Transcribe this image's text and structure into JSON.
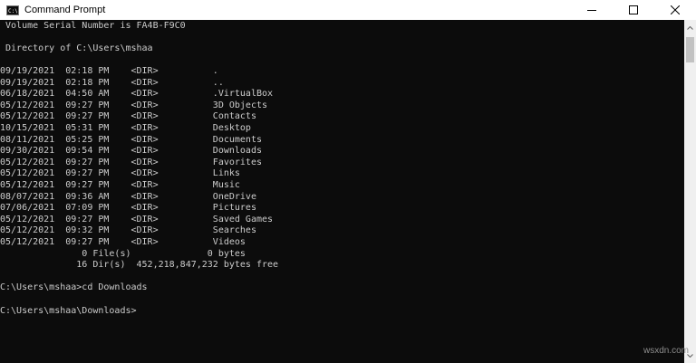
{
  "window": {
    "title": "Command Prompt"
  },
  "console": {
    "lines": [
      " Volume Serial Number is FA4B-F9C0",
      "",
      " Directory of C:\\Users\\mshaa",
      "",
      "09/19/2021  02:18 PM    <DIR>          .",
      "09/19/2021  02:18 PM    <DIR>          ..",
      "06/18/2021  04:50 AM    <DIR>          .VirtualBox",
      "05/12/2021  09:27 PM    <DIR>          3D Objects",
      "05/12/2021  09:27 PM    <DIR>          Contacts",
      "10/15/2021  05:31 PM    <DIR>          Desktop",
      "08/11/2021  05:25 PM    <DIR>          Documents",
      "09/30/2021  09:54 PM    <DIR>          Downloads",
      "05/12/2021  09:27 PM    <DIR>          Favorites",
      "05/12/2021  09:27 PM    <DIR>          Links",
      "05/12/2021  09:27 PM    <DIR>          Music",
      "08/07/2021  09:36 AM    <DIR>          OneDrive",
      "07/06/2021  07:09 PM    <DIR>          Pictures",
      "05/12/2021  09:27 PM    <DIR>          Saved Games",
      "05/12/2021  09:32 PM    <DIR>          Searches",
      "05/12/2021  09:27 PM    <DIR>          Videos",
      "               0 File(s)              0 bytes",
      "              16 Dir(s)  452,218,847,232 bytes free",
      "",
      "C:\\Users\\mshaa>cd Downloads",
      "",
      "C:\\Users\\mshaa\\Downloads>"
    ]
  },
  "watermark": "wsxdn.com",
  "icons": {
    "app": "command-prompt-icon",
    "minimize": "minimize-icon",
    "maximize": "maximize-icon",
    "close": "close-icon",
    "scroll_up": "scroll-up-arrow-icon",
    "scroll_down": "scroll-down-arrow-icon"
  },
  "colors": {
    "background": "#0c0c0c",
    "text": "#cccccc",
    "titlebar": "#ffffff"
  }
}
